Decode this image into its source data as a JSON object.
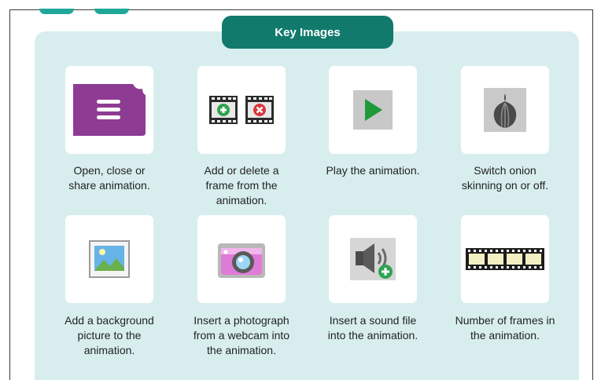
{
  "title": "Key Images",
  "items": [
    {
      "icon": "notebook-menu-icon",
      "caption": "Open, close or\nshare animation."
    },
    {
      "icon": "add-delete-frame-icon",
      "caption": "Add or delete a\nframe from the\nanimation."
    },
    {
      "icon": "play-icon",
      "caption": "Play the animation."
    },
    {
      "icon": "onion-icon",
      "caption": "Switch onion\nskinning on or off."
    },
    {
      "icon": "picture-icon",
      "caption": "Add a background\npicture to the\nanimation."
    },
    {
      "icon": "webcam-icon",
      "caption": "Insert a photograph\nfrom a webcam into\nthe animation."
    },
    {
      "icon": "sound-add-icon",
      "caption": "Insert a sound file\ninto the animation."
    },
    {
      "icon": "film-strip-icon",
      "caption": "Number of frames in\nthe animation."
    }
  ],
  "colors": {
    "accent": "#117a6d",
    "panel": "#d8eeee",
    "purple": "#8e3b94",
    "play": "#1f9a3a"
  }
}
